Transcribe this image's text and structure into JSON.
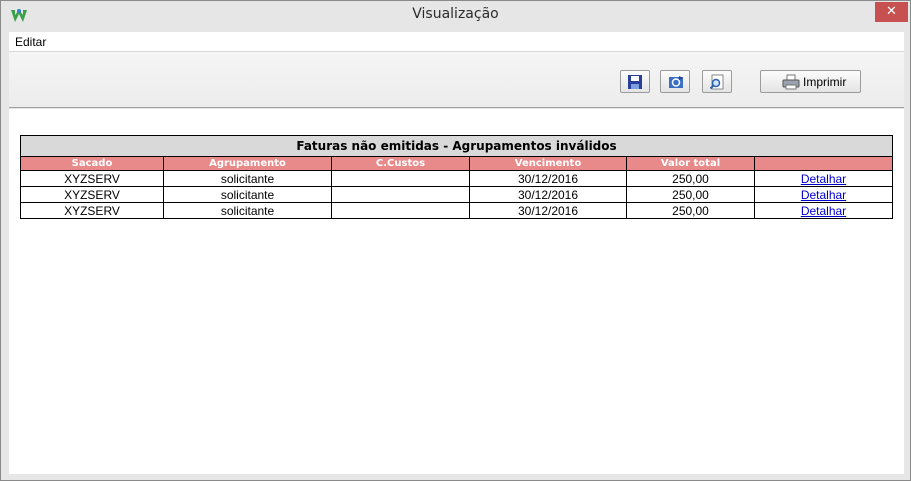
{
  "window": {
    "title": "Visualização",
    "close_glyph": "✕"
  },
  "menu": {
    "items": [
      {
        "label": "Editar"
      }
    ]
  },
  "toolbar": {
    "buttons": [
      {
        "name": "save-icon"
      },
      {
        "name": "refresh-icon"
      },
      {
        "name": "zoom-icon"
      }
    ],
    "print_label": "Imprimir"
  },
  "report": {
    "title": "Faturas não emitidas - Agrupamentos inválidos",
    "columns": [
      "Sacado",
      "Agrupamento",
      "C.Custos",
      "Vencimento",
      "Valor total",
      ""
    ],
    "rows": [
      {
        "sacado": "XYZSERV",
        "agrupamento": "solicitante",
        "ccustos": "",
        "vencimento": "30/12/2016",
        "valor": "250,00",
        "acao": "Detalhar"
      },
      {
        "sacado": "XYZSERV",
        "agrupamento": "solicitante",
        "ccustos": "",
        "vencimento": "30/12/2016",
        "valor": "250,00",
        "acao": "Detalhar"
      },
      {
        "sacado": "XYZSERV",
        "agrupamento": "solicitante",
        "ccustos": "",
        "vencimento": "30/12/2016",
        "valor": "250,00",
        "acao": "Detalhar"
      }
    ]
  },
  "colors": {
    "header_bg": "#e88a8a",
    "title_bg": "#d9d9d9",
    "close_bg": "#c75050",
    "link": "#0000cc"
  }
}
